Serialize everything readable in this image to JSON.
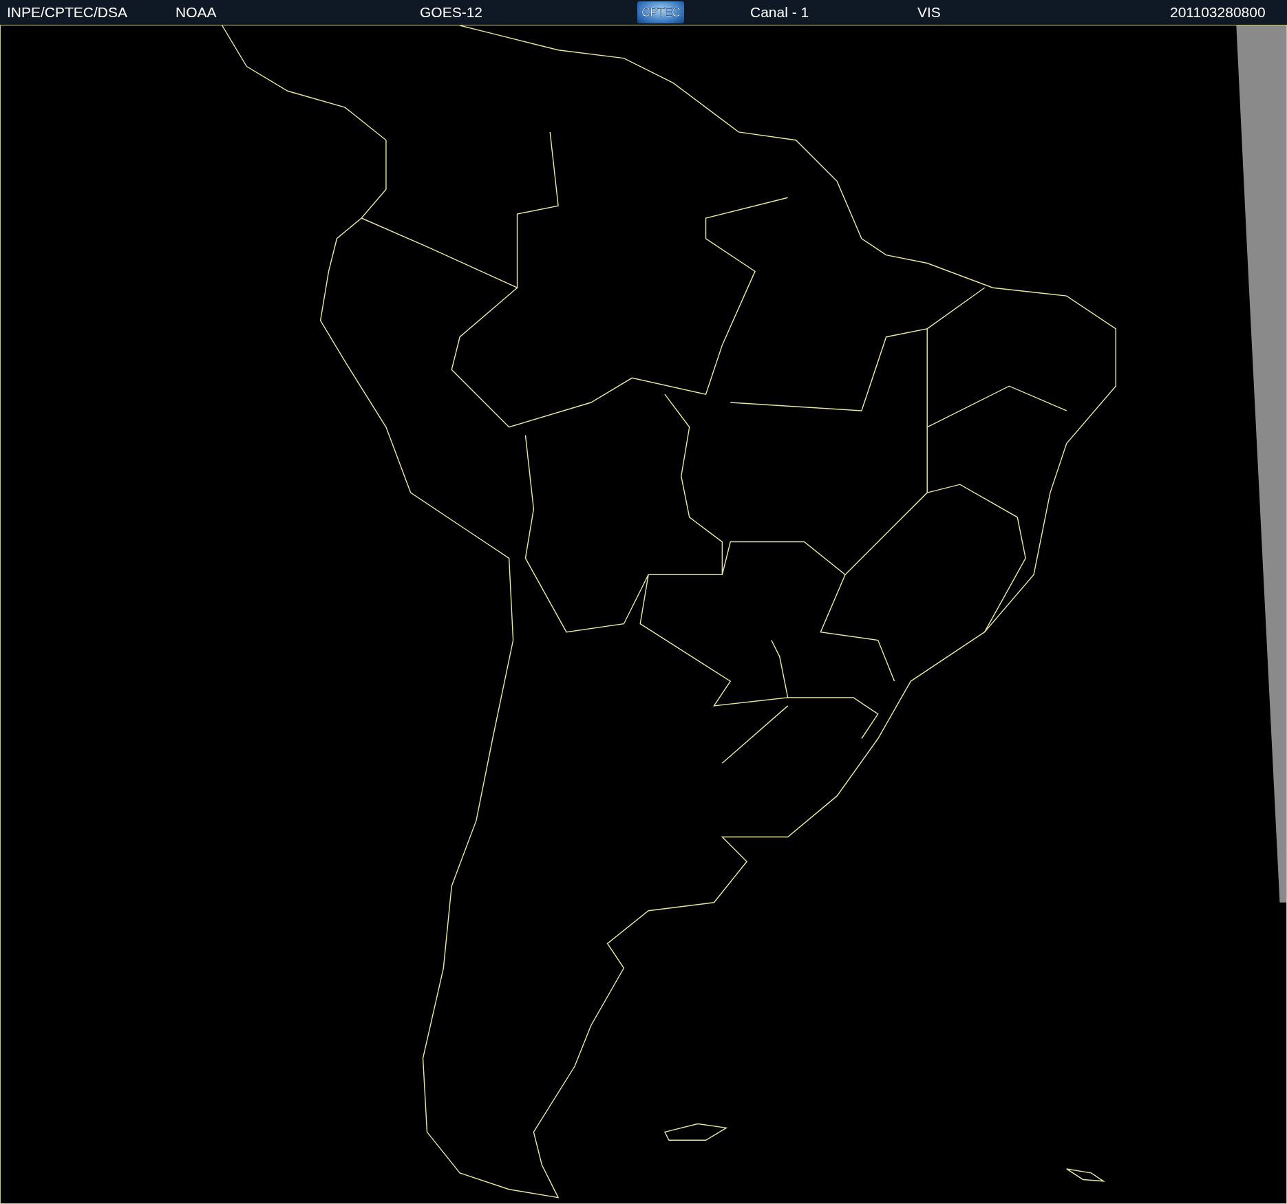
{
  "header": {
    "items": [
      {
        "kind": "text",
        "text": "INPE/CPTEC/DSA"
      },
      {
        "kind": "text",
        "text": "NOAA"
      },
      {
        "kind": "text",
        "text": "GOES-12"
      },
      {
        "kind": "logo",
        "text": "CPTEC"
      },
      {
        "kind": "text",
        "text": "Canal - 1"
      },
      {
        "kind": "text",
        "text": "VIS"
      },
      {
        "kind": "text",
        "text": "201103280800"
      }
    ]
  }
}
